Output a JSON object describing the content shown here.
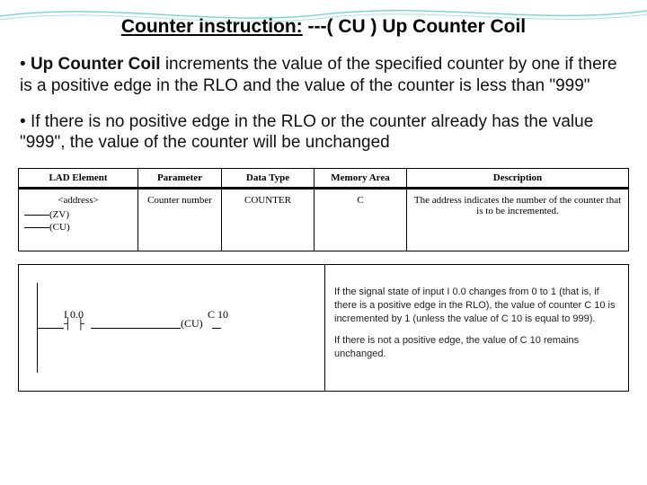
{
  "title_underline": "Counter instruction:",
  "title_rest": " ---( CU ) Up Counter Coil",
  "bullet1_lead": "Up Counter Coil",
  "bullet1_rest": " increments the value of the specified counter by one if there is a positive edge in the RLO and the value of the counter is less than \"999\"",
  "bullet2": "If there is no positive edge in the RLO or the counter already has the value \"999\", the value of the counter will be unchanged",
  "table1": {
    "headers": [
      "LAD Element",
      "Parameter",
      "Data Type",
      "Memory Area",
      "Description"
    ],
    "row": {
      "addr": "<address>",
      "zv": "ZV",
      "cu": "CU",
      "parameter": "Counter number",
      "datatype": "COUNTER",
      "memarea": "C",
      "description": "The address indicates the number of the counter that is to be incremented."
    }
  },
  "ladder": {
    "input_label": "I 0.0",
    "counter_label": "C 10",
    "coil": "CU"
  },
  "desc2": {
    "p1": "If the signal state of input I 0.0 changes from 0 to 1 (that is, if there is a positive edge in the RLO), the value of counter C 10 is incremented by 1 (unless the value of C 10 is equal to 999).",
    "p2": "If there is not a positive edge, the value of C 10 remains unchanged."
  }
}
